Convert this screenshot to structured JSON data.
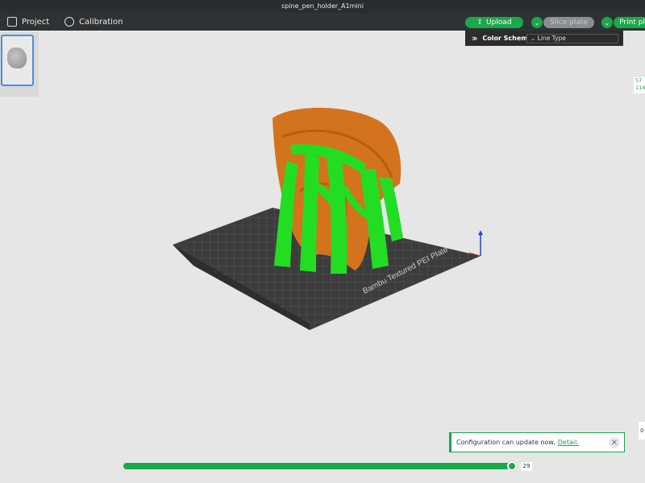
{
  "window": {
    "title": "spine_pen_holder_A1mini"
  },
  "menu": {
    "project": "Project",
    "calibration": "Calibration"
  },
  "toolbar": {
    "upload": "Upload",
    "slice_plate": "Slice plate",
    "print_plate": "Print pl"
  },
  "color_scheme": {
    "label": "Color Scheme",
    "value": "Line Type"
  },
  "side_box": {
    "top_line1": "57",
    "top_line2": "114",
    "bottom": "0"
  },
  "bed": {
    "label": "Bambu Textured PEI Plate"
  },
  "notification": {
    "message": "Configuration can update now.",
    "link": "Detail."
  },
  "layer_slider": {
    "value": "29",
    "fraction": 0.99
  },
  "colors": {
    "accent": "#1aa84a",
    "support": "#22dd22",
    "model": "#d4731d"
  }
}
